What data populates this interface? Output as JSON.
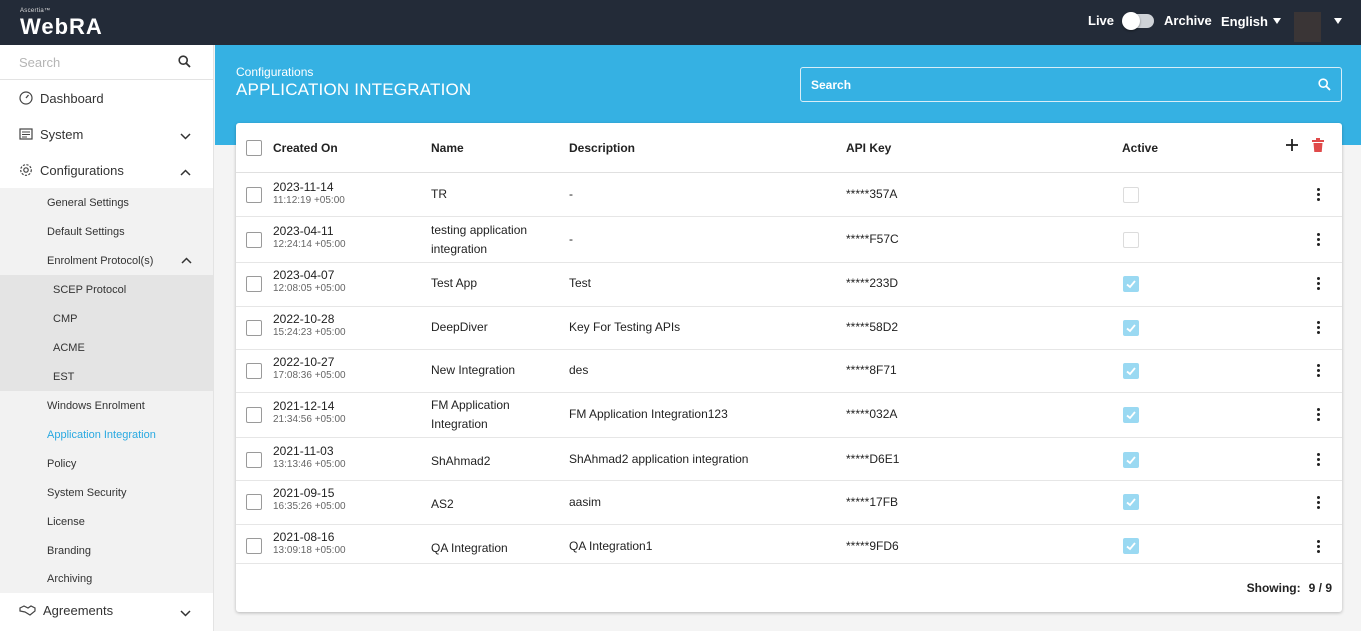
{
  "header": {
    "brand_super": "Ascertia™",
    "brand_name": "WebRA",
    "live_label": "Live",
    "archive_label": "Archive",
    "language": "English"
  },
  "sidebar": {
    "search_placeholder": "Search",
    "dashboard": "Dashboard",
    "system": "System",
    "configurations": "Configurations",
    "config_items": {
      "general_settings": "General Settings",
      "default_settings": "Default Settings",
      "enrolment_protocols": "Enrolment Protocol(s)",
      "scep": "SCEP Protocol",
      "cmp": "CMP",
      "acme": "ACME",
      "est": "EST",
      "windows_enrolment": "Windows Enrolment",
      "application_integration": "Application Integration",
      "policy": "Policy",
      "system_security": "System Security",
      "license": "License",
      "branding": "Branding",
      "archiving": "Archiving"
    },
    "agreements": "Agreements"
  },
  "page": {
    "breadcrumb": "Configurations",
    "title": "APPLICATION INTEGRATION",
    "search_placeholder": "Search"
  },
  "table": {
    "columns": {
      "created_on": "Created On",
      "name": "Name",
      "description": "Description",
      "api_key": "API Key",
      "active": "Active"
    },
    "rows": [
      {
        "date": "2023-11-14",
        "time": "11:12:19 +05:00",
        "name": "TR",
        "description": "-",
        "api_key": "*****357A",
        "active": false
      },
      {
        "date": "2023-04-11",
        "time": "12:24:14 +05:00",
        "name": "testing application integration",
        "description": "-",
        "api_key": "*****F57C",
        "active": false
      },
      {
        "date": "2023-04-07",
        "time": "12:08:05 +05:00",
        "name": "Test App",
        "description": "Test",
        "api_key": "*****233D",
        "active": true
      },
      {
        "date": "2022-10-28",
        "time": "15:24:23 +05:00",
        "name": "DeepDiver",
        "description": "Key For Testing APIs",
        "api_key": "*****58D2",
        "active": true
      },
      {
        "date": "2022-10-27",
        "time": "17:08:36 +05:00",
        "name": "New Integration",
        "description": "des",
        "api_key": "*****8F71",
        "active": true
      },
      {
        "date": "2021-12-14",
        "time": "21:34:56 +05:00",
        "name": "FM Application Integration",
        "description": "FM Application Integration123",
        "api_key": "*****032A",
        "active": true
      },
      {
        "date": "2021-11-03",
        "time": "13:13:46 +05:00",
        "name": "ShAhmad2",
        "description": "ShAhmad2 application integration",
        "api_key": "*****D6E1",
        "active": true
      },
      {
        "date": "2021-09-15",
        "time": "16:35:26 +05:00",
        "name": "AS2",
        "description": "aasim",
        "api_key": "*****17FB",
        "active": true
      },
      {
        "date": "2021-08-16",
        "time": "13:09:18 +05:00",
        "name": "QA Integration",
        "description": "QA Integration1",
        "api_key": "*****9FD6",
        "active": true
      }
    ],
    "showing_label": "Showing:",
    "showing_value": "9 / 9"
  },
  "colors": {
    "topbar": "#232b38",
    "accent": "#35b1e3",
    "active_link": "#29a9e1",
    "delete_icon": "#e04a4a",
    "active_check": "#9ad9f2"
  },
  "icons": [
    "search-icon",
    "dashboard-icon",
    "system-icon",
    "gear-icon",
    "chevron-down-icon",
    "chevron-up-icon",
    "handshake-icon",
    "plus-icon",
    "trash-icon",
    "kebab-icon",
    "caret-down-icon"
  ]
}
